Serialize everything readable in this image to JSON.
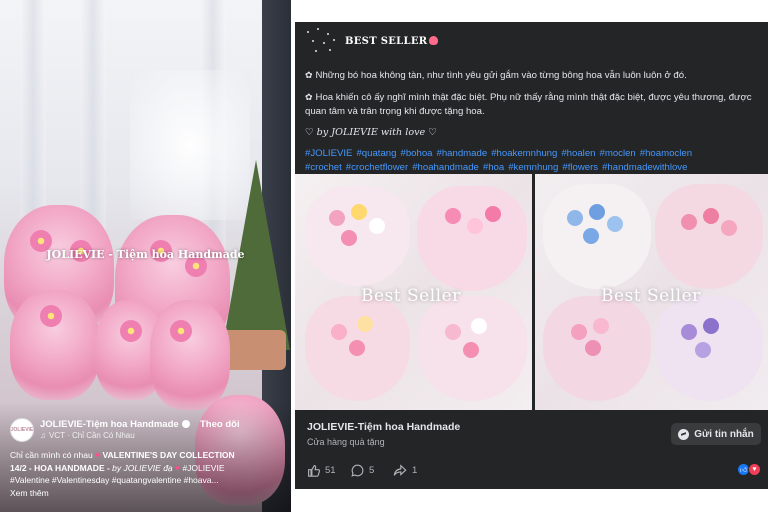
{
  "reel": {
    "watermark": "JOLIEVIE - Tiệm hoa Handmade",
    "avatar_text": "JOLIEVIE",
    "page_name": "JOLIEVIE-Tiệm hoa Handmade",
    "follow_label": "Theo dõi",
    "music": "VCT · Chỉ Cần Có Nhau",
    "caption_line1_a": "Chỉ cần mình có nhau ",
    "caption_line1_b": " VALENTINE'S DAY COLLECTION",
    "caption_line2_a": "14/2 - HOA HANDMADE - ",
    "caption_line2_b": "by JOLIEVIE đạ",
    "caption_line2_c": " #JOLIEVIE",
    "caption_line3": "#Valentine    #Valentinesday #quatangvalentine #hoava...",
    "see_more": "Xem thêm"
  },
  "post": {
    "title": "BEST SELLER",
    "para1": "Những bó hoa không tàn, như tình yêu gửi gắm vào từng bông hoa vẫn luôn luôn ở đó.",
    "para2": "Hoa khiến cô ấy nghĩ mình thật đặc biệt. Phụ nữ thấy rằng mình thật đặc biệt, được yêu thương, được quan tâm và trân trọng khi được tặng hoa.",
    "signature": "♡ by JOLIEVIE with love ♡",
    "hashtags": [
      "#JOLIEVIE",
      "#quatang",
      "#bohoa",
      "#handmade",
      "#hoakemnhung",
      "#hoalen",
      "#moclen",
      "#hoamoclen",
      "#crochet",
      "#crochetflower",
      "#hoahandmade",
      "#hoa",
      "#kemnhung",
      "#flowers",
      "#handmadewithlove"
    ],
    "grid_label_left": "Best Seller",
    "grid_label_right": "Best Seller",
    "page_name": "JOLIEVIE-Tiệm hoa Handmade",
    "page_category": "Cửa hàng quà tặng",
    "message_button": "Gửi tin nhắn",
    "likes": "51",
    "comments": "5",
    "shares": "1"
  },
  "colors": {
    "post_bg": "#242526",
    "hashtag": "#4599ff",
    "like_blue": "#1877f2",
    "love_red": "#f33e58"
  },
  "icons": [
    "music-note-icon",
    "verified-icon",
    "tulip-icon",
    "clover-icon",
    "messenger-icon",
    "like-icon",
    "comment-icon",
    "share-icon",
    "like-reaction-icon",
    "love-reaction-icon"
  ]
}
